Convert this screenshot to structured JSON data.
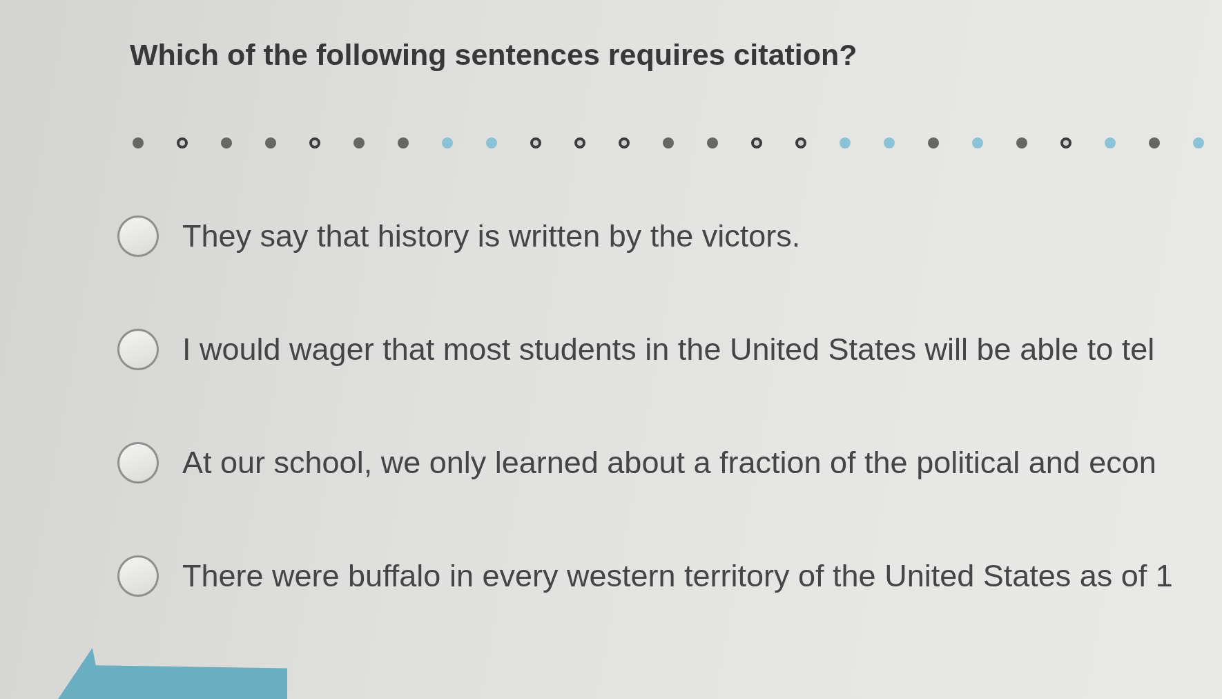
{
  "question": {
    "text": "Which of the following sentences requires citation?"
  },
  "progress_dots": [
    {
      "kind": "filled"
    },
    {
      "kind": "ring"
    },
    {
      "kind": "filled"
    },
    {
      "kind": "filled"
    },
    {
      "kind": "ring"
    },
    {
      "kind": "filled"
    },
    {
      "kind": "filled"
    },
    {
      "kind": "tinted"
    },
    {
      "kind": "tinted"
    },
    {
      "kind": "ring"
    },
    {
      "kind": "ring"
    },
    {
      "kind": "ring"
    },
    {
      "kind": "filled"
    },
    {
      "kind": "filled"
    },
    {
      "kind": "ring"
    },
    {
      "kind": "ring"
    },
    {
      "kind": "tinted"
    },
    {
      "kind": "tinted"
    },
    {
      "kind": "filled"
    },
    {
      "kind": "tinted"
    },
    {
      "kind": "filled"
    },
    {
      "kind": "ring"
    },
    {
      "kind": "tinted"
    },
    {
      "kind": "filled"
    },
    {
      "kind": "tinted"
    }
  ],
  "options": [
    {
      "text": "They say that history is written by the victors.",
      "selected": false
    },
    {
      "text": "I would wager that most students in the United States will be able to tel",
      "selected": false
    },
    {
      "text": "At our school, we only learned about a fraction of the political and econ",
      "selected": false
    },
    {
      "text": "There were buffalo in every western territory of the United States as of 1",
      "selected": false
    }
  ]
}
